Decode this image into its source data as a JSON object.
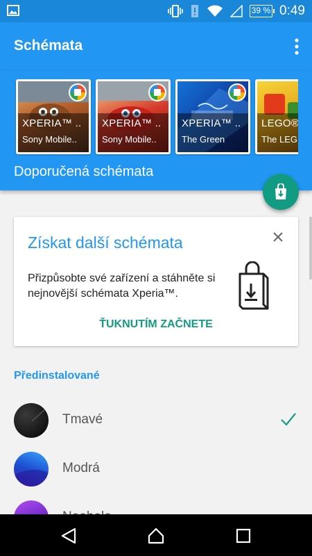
{
  "status_bar": {
    "battery": "39 %",
    "time": "0:49",
    "icons": [
      "image-icon",
      "vibrate-icon",
      "alert-icon",
      "wifi-icon",
      "signal-icon",
      "battery-icon"
    ]
  },
  "app_bar": {
    "title": "Schémata",
    "menu_icon": "more-vert-icon"
  },
  "featured": {
    "cards": [
      {
        "title": "XPERIA™ ..",
        "subtitle": "Sony Mobile..",
        "icon": "store-badge-icon"
      },
      {
        "title": "XPERIA™ ..",
        "subtitle": "Sony Mobile..",
        "icon": "store-badge-icon"
      },
      {
        "title": "XPERIA™ ..",
        "subtitle": "The Green",
        "icon": "store-badge-icon"
      },
      {
        "title": "LEGO® ..",
        "subtitle": "The LEG",
        "icon": "store-badge-icon"
      }
    ],
    "label": "Doporučená schémata",
    "fab_icon": "store-download-icon"
  },
  "promo": {
    "title": "Získat další schémata",
    "body": "Přizpůsobte své zařízení a stáhněte si nejnovější schémata Xperia™.",
    "action": "ŤUKNUTÍM ZAČNETE",
    "close_icon": "close-icon",
    "bag_icon": "shopping-bag-download-icon"
  },
  "preinstalled": {
    "header": "Předinstalované",
    "themes": [
      {
        "name": "Tmavé",
        "selected": true
      },
      {
        "name": "Modrá",
        "selected": false
      },
      {
        "name": "Neoholo",
        "selected": false
      }
    ]
  },
  "colors": {
    "accent": "#2196f3",
    "status_bar": "#1a87d8",
    "teal": "#129b83"
  },
  "nav": {
    "icons": [
      "back-icon",
      "home-icon",
      "recents-icon"
    ]
  }
}
